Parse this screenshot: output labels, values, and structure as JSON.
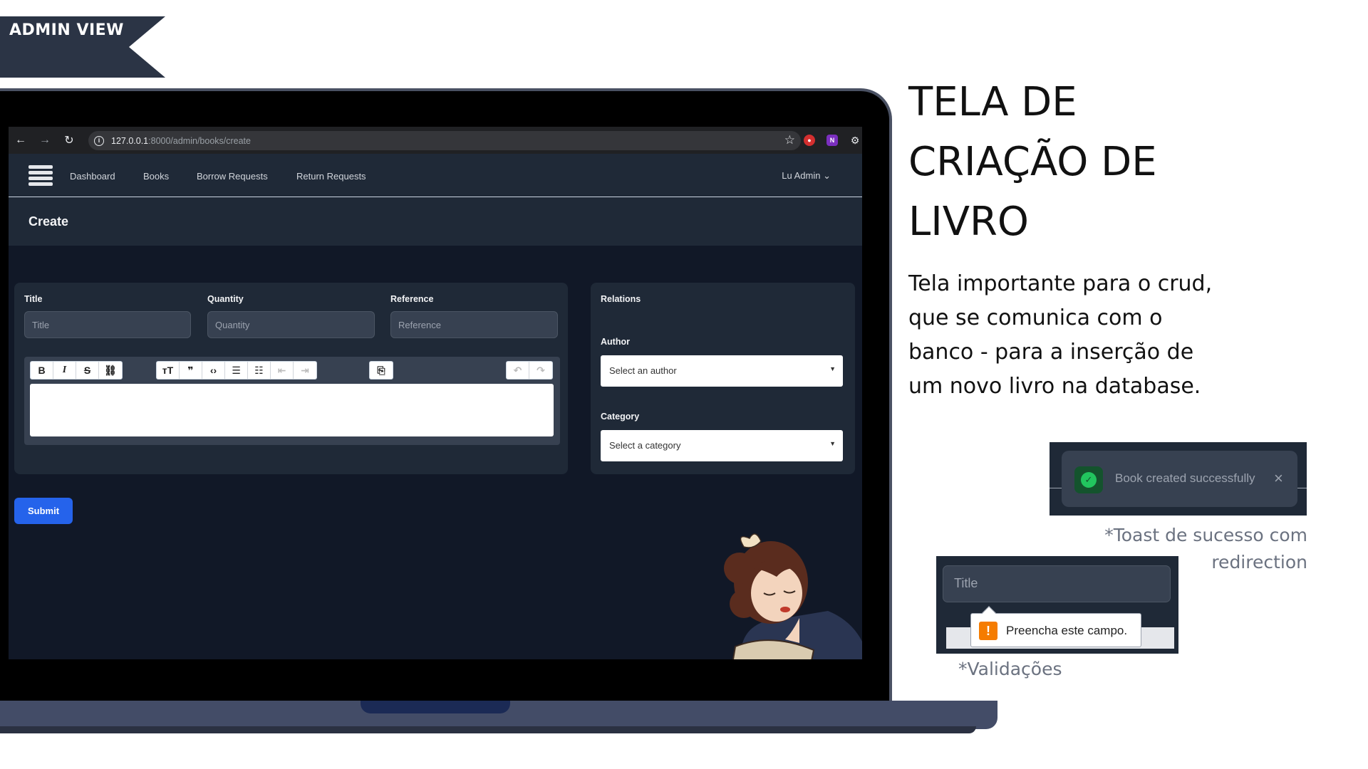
{
  "ribbon": {
    "label": "ADMIN VIEW"
  },
  "browser": {
    "url_host": "127.0.0.1",
    "url_path": ":8000/admin/books/create",
    "back_icon": "arrow-left-icon",
    "forward_icon": "arrow-right-icon",
    "reload_icon": "reload-icon",
    "bookmark_icon": "star-icon"
  },
  "app_nav": {
    "items": [
      {
        "label": "Dashboard"
      },
      {
        "label": "Books"
      },
      {
        "label": "Borrow Requests"
      },
      {
        "label": "Return Requests"
      }
    ],
    "user": "Lu Admin"
  },
  "page": {
    "title": "Create"
  },
  "form": {
    "title_label": "Title",
    "title_placeholder": "Title",
    "quantity_label": "Quantity",
    "quantity_placeholder": "Quantity",
    "reference_label": "Reference",
    "reference_placeholder": "Reference",
    "toolbar_icons": [
      "bold-icon",
      "italic-icon",
      "strikethrough-icon",
      "link-icon",
      "heading-icon",
      "quote-icon",
      "code-icon",
      "bullet-list-icon",
      "numbered-list-icon",
      "outdent-icon",
      "indent-icon",
      "attach-icon",
      "undo-icon",
      "redo-icon"
    ],
    "submit_label": "Submit"
  },
  "relations": {
    "title": "Relations",
    "author_label": "Author",
    "author_value": "Select an author",
    "category_label": "Category",
    "category_value": "Select a category"
  },
  "slide": {
    "heading_lines": [
      "TELA DE",
      "CRIAÇÃO DE",
      "LIVRO"
    ],
    "description": "Tela importante para o crud, que se comunica com o banco - para a inserção de um novo livro na database."
  },
  "toast": {
    "message": "Book created successfully",
    "caption": "*Toast de sucesso com redirection"
  },
  "validation": {
    "input_placeholder": "Title",
    "message": "Preencha este campo.",
    "caption": "*Validações"
  },
  "colors": {
    "ribbon": "#2b3445",
    "app_background": "#111827",
    "card": "#1f2937",
    "submit": "#2563eb",
    "success": "#22c55e",
    "warning": "#f57c00"
  }
}
